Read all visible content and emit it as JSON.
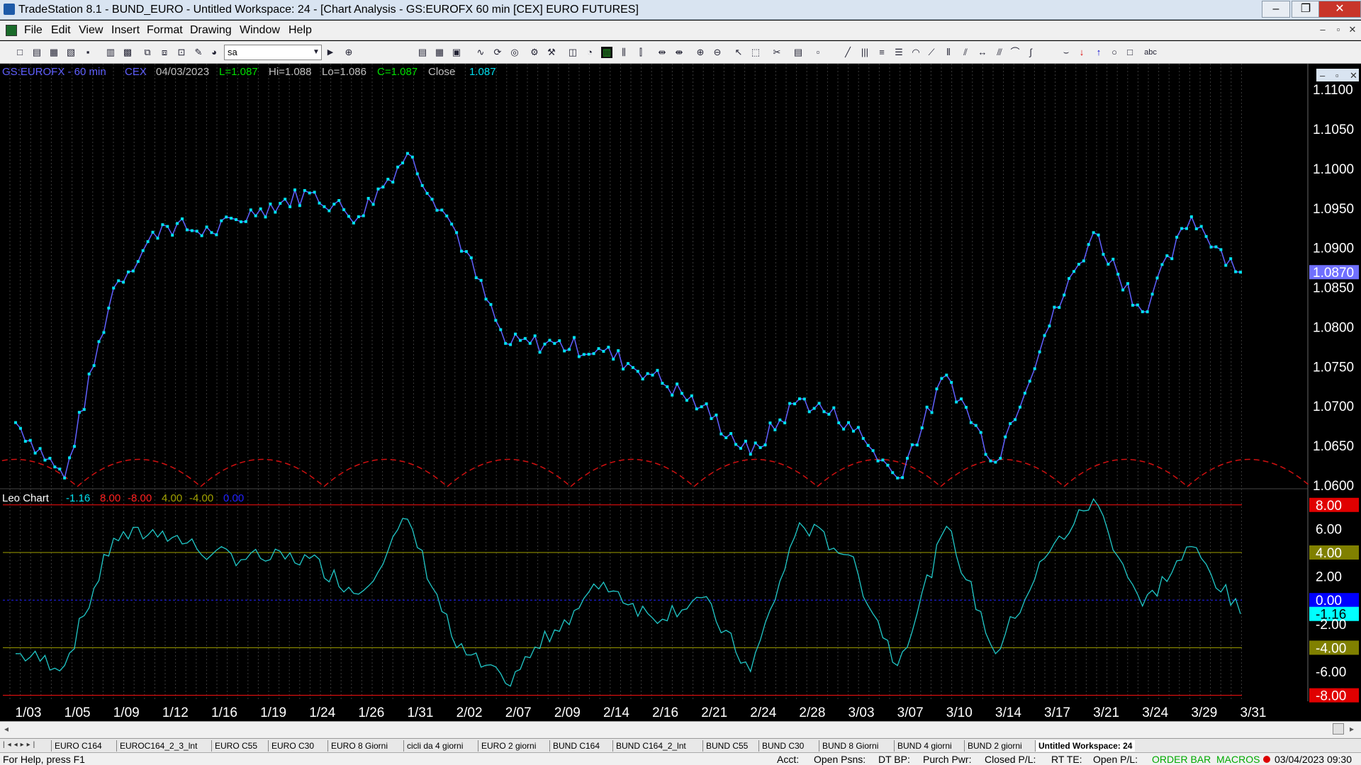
{
  "window": {
    "title": "TradeStation 8.1 - BUND_EURO - Untitled Workspace:  24 - [Chart Analysis - GS:EUROFX  60 min  [CEX] EURO FUTURES]",
    "minimize": "–",
    "restore": "❐",
    "close": "✕"
  },
  "menu": {
    "items": [
      "File",
      "Edit",
      "View",
      "Insert",
      "Format",
      "Drawing",
      "Window",
      "Help"
    ]
  },
  "mdi": {
    "minimize": "–",
    "restore": "▫",
    "close": "✕"
  },
  "toolbar": {
    "symbol_value": "sa"
  },
  "chart": {
    "header": {
      "symbol": "GS:EUROFX - 60 min",
      "exchange": "CEX",
      "date": "04/03/2023",
      "low": "L=1.087",
      "high": "Hi=1.088",
      "lo": "Lo=1.086",
      "close": "C=1.087",
      "close_label": "Close",
      "close_value": "1.087"
    },
    "price_axis": [
      "1.1100",
      "1.1050",
      "1.1000",
      "1.0950",
      "1.0900",
      "1.0850",
      "1.0800",
      "1.0750",
      "1.0700",
      "1.0650",
      "1.0600"
    ],
    "last_price": "1.0870",
    "indicator": {
      "name": "Leo Chart",
      "values": [
        "-1.16",
        "8.00",
        "-8.00",
        "4.00",
        "-4.00",
        "0.00"
      ],
      "axis": [
        "8.00",
        "6.00",
        "4.00",
        "2.00",
        "0.00",
        "-1.16",
        "-2.00",
        "-4.00",
        "-6.00",
        "-8.00"
      ]
    },
    "dates": [
      "1/03",
      "1/05",
      "1/09",
      "1/12",
      "1/16",
      "1/19",
      "1/24",
      "1/26",
      "1/31",
      "2/02",
      "2/07",
      "2/09",
      "2/14",
      "2/16",
      "2/21",
      "2/24",
      "2/28",
      "3/03",
      "3/07",
      "3/10",
      "3/14",
      "3/17",
      "3/21",
      "3/24",
      "3/29",
      "3/31"
    ],
    "colors": {
      "price_line": "#6060ff",
      "price_dot": "#00e0f0",
      "cycle": "#d01010",
      "oscillator": "#20c8c8",
      "level_8": "#ff1010",
      "level_4": "#a0a000",
      "level_0": "#2020ff",
      "label_bg_8": "#e00000",
      "label_bg_4": "#808000",
      "label_bg_0": "#0000ff",
      "label_bg_m116": "#00ffff",
      "label_bg_price": "#7070ff"
    }
  },
  "chart_data": {
    "type": "line",
    "title": "GS:EUROFX - 60 min",
    "x": [
      "1/03",
      "1/05",
      "1/09",
      "1/12",
      "1/16",
      "1/19",
      "1/24",
      "1/26",
      "1/31",
      "2/02",
      "2/07",
      "2/09",
      "2/14",
      "2/16",
      "2/21",
      "2/24",
      "2/28",
      "3/03",
      "3/07",
      "3/10",
      "3/14",
      "3/17",
      "3/21",
      "3/24",
      "3/29",
      "3/31"
    ],
    "series": [
      {
        "name": "Close",
        "values": [
          1.068,
          1.061,
          1.085,
          1.093,
          1.092,
          1.095,
          1.097,
          1.094,
          1.102,
          1.092,
          1.078,
          1.078,
          1.077,
          1.074,
          1.07,
          1.064,
          1.071,
          1.068,
          1.061,
          1.074,
          1.063,
          1.079,
          1.092,
          1.082,
          1.094,
          1.087
        ]
      },
      {
        "name": "Leo Chart",
        "values": [
          -4.5,
          -5.5,
          5.2,
          5.8,
          3.8,
          3.5,
          3.5,
          0.5,
          6.8,
          -4.0,
          -7.0,
          -2.5,
          1.5,
          -1.5,
          0.2,
          -6.0,
          6.5,
          3.8,
          -5.5,
          6.2,
          -4.5,
          3.5,
          8.5,
          -0.5,
          4.5,
          -1.16
        ]
      }
    ],
    "ylim": [
      1.06,
      1.111
    ],
    "indicator_ylim": [
      -8.5,
      9
    ],
    "indicator_levels": [
      8,
      4,
      0,
      -4,
      -8
    ]
  },
  "tabs": [
    "EURO C164",
    "EUROC164_2_3_lnt",
    "EURO C55",
    "EURO C30",
    "EURO 8 Giorni",
    "cicli da 4 giorni",
    "EURO 2 giorni",
    "BUND C164",
    "BUND C164_2_lnt",
    "BUND C55",
    "BUND  C30",
    "BUND 8 Giorni",
    "BUND 4 giorni",
    "BUND 2 giorni",
    "Untitled Workspace:  24"
  ],
  "status": {
    "help": "For Help, press F1",
    "acct": "Acct:",
    "open_psns": "Open Psns:",
    "dt_bp": "DT BP:",
    "purch_pwr": "Purch Pwr:",
    "closed_pl": "Closed P/L:",
    "rt_te": "RT TE:",
    "open_pl": "Open P/L:",
    "order_bar": "ORDER BAR",
    "macros": "MACROS",
    "datetime": "03/04/2023 09:30"
  }
}
